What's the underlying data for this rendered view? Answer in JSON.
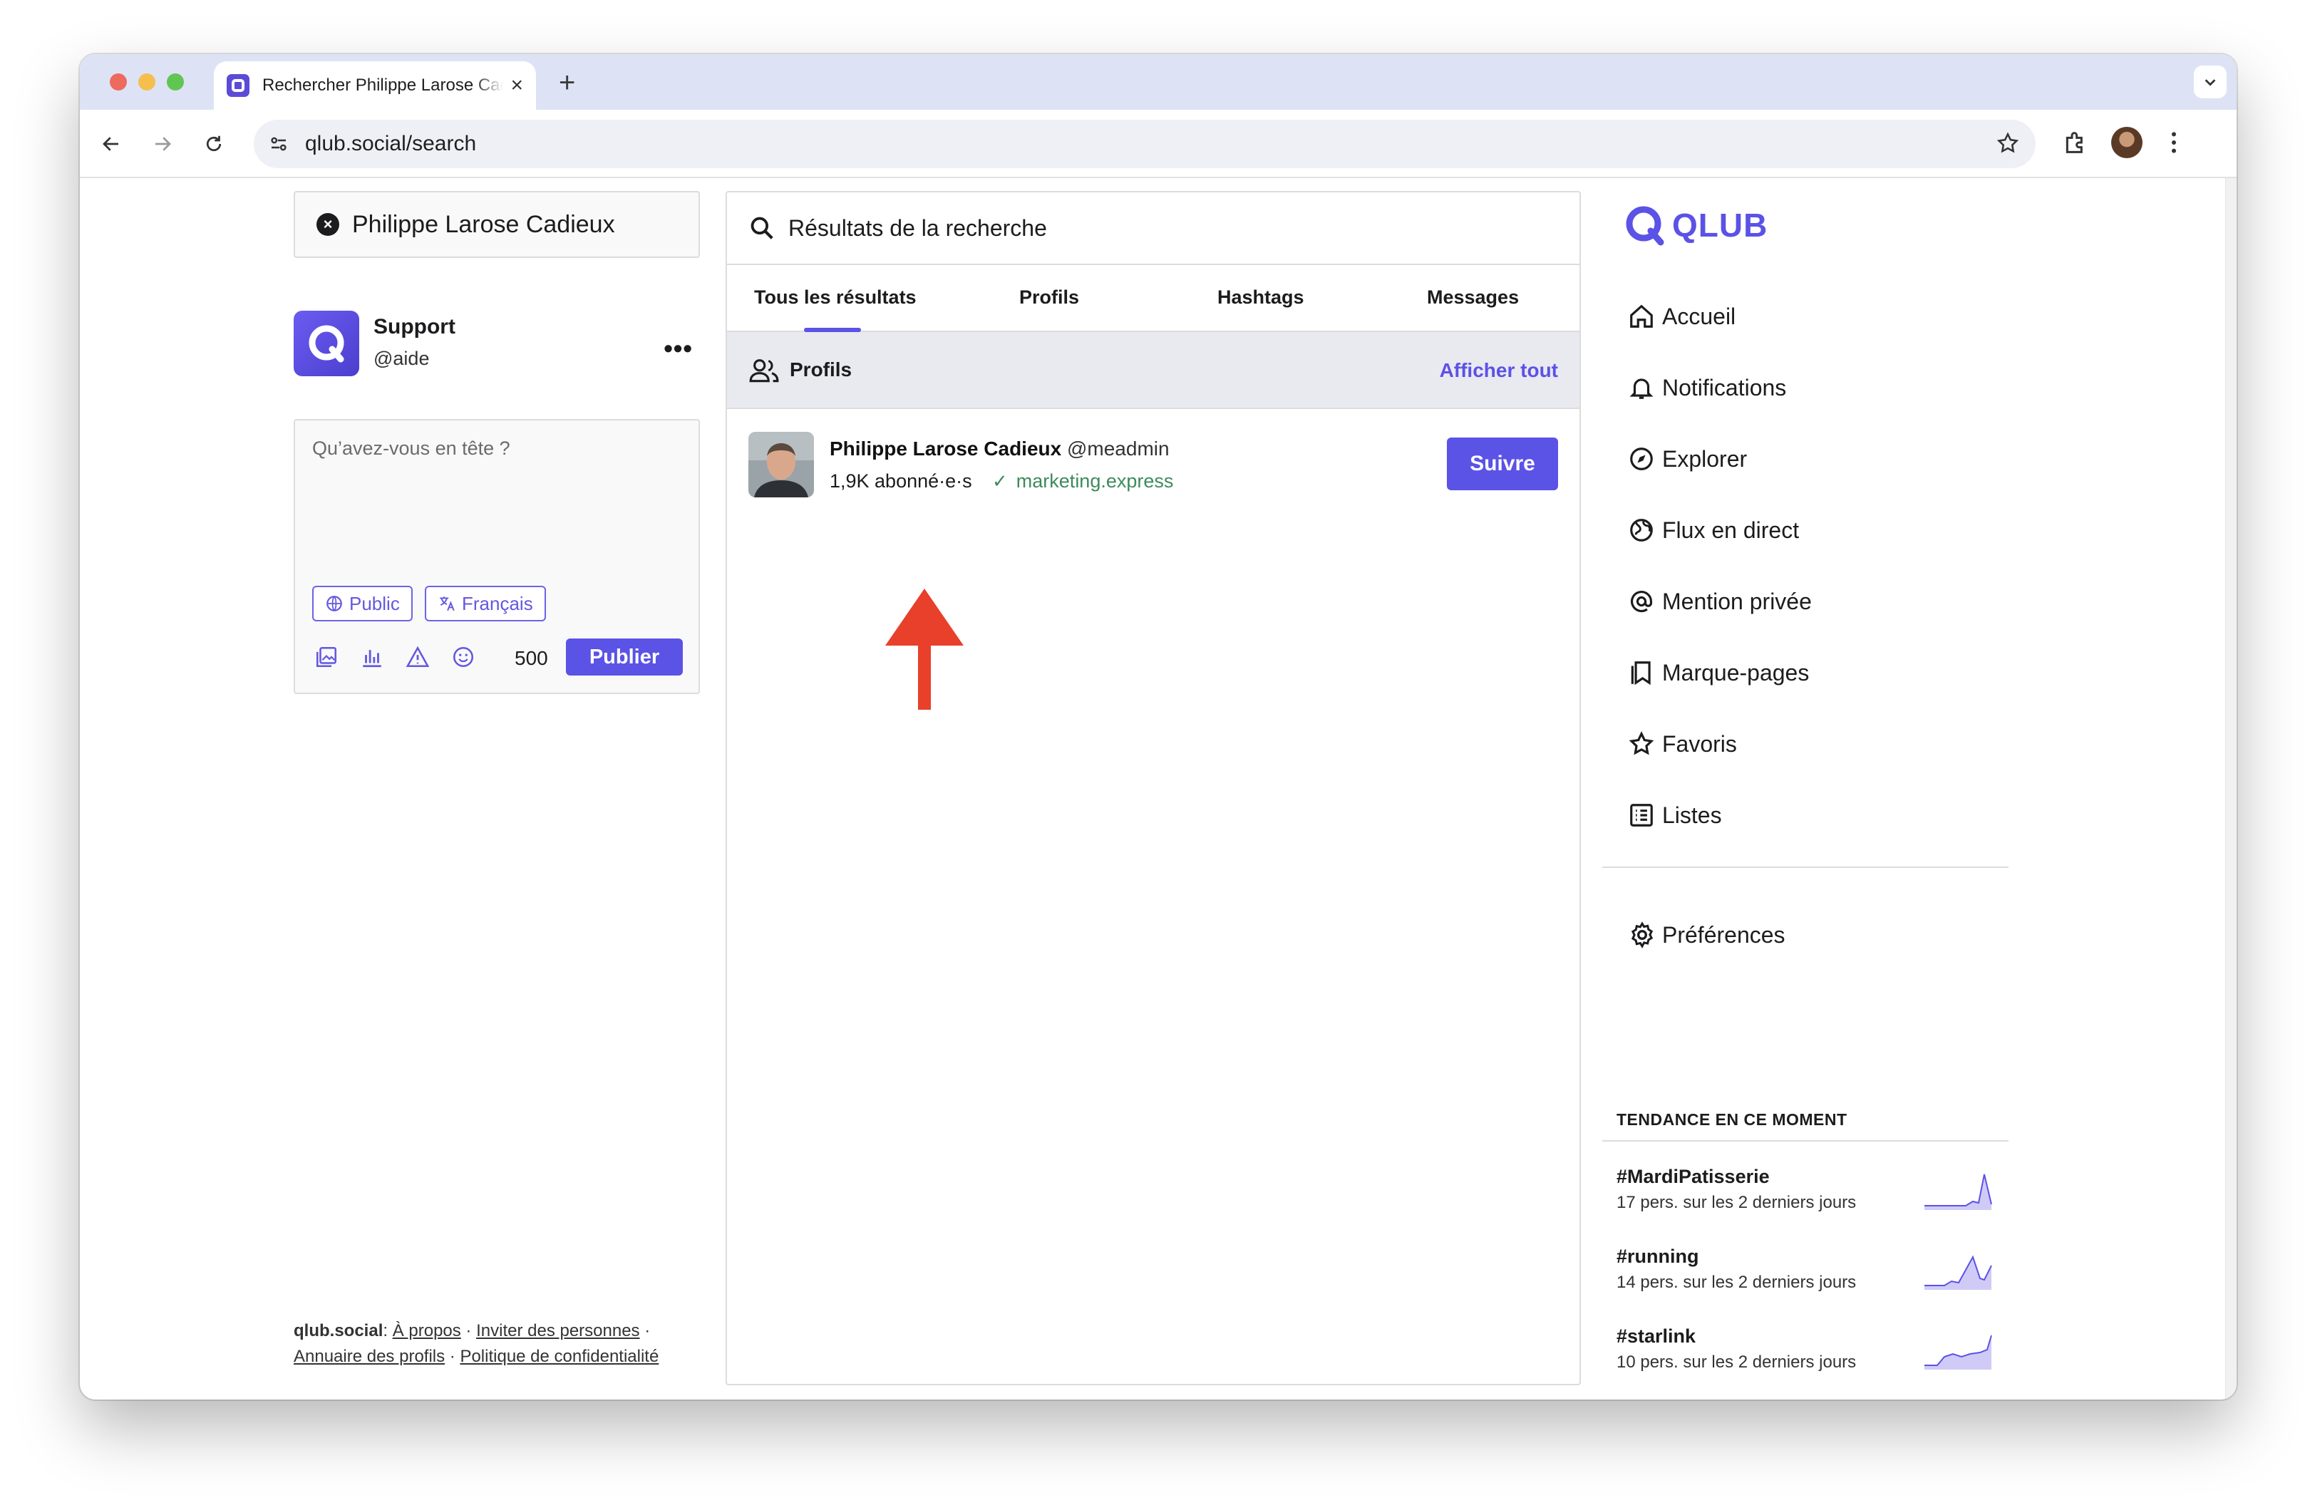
{
  "browser": {
    "tab_title": "Rechercher Philippe Larose Cadieux",
    "url": "qlub.social/search"
  },
  "left": {
    "search_value": "Philippe Larose Cadieux",
    "account": {
      "name": "Support",
      "handle": "@aide",
      "menu": "•••"
    },
    "composer": {
      "placeholder": "Qu’avez-vous en tête ?",
      "visibility": "Public",
      "language": "Français",
      "char_count": "500",
      "publish_label": "Publier"
    },
    "footer": {
      "site": "qlub.social",
      "about": "À propos",
      "invite": "Inviter des personnes",
      "directory": "Annuaire des profils",
      "privacy": "Politique de confidentialité"
    }
  },
  "results": {
    "title": "Résultats de la recherche",
    "tabs": [
      "Tous les résultats",
      "Profils",
      "Hashtags",
      "Messages"
    ],
    "section_title": "Profils",
    "show_all": "Afficher tout",
    "profile": {
      "name": "Philippe Larose Cadieux",
      "handle": "@meadmin",
      "followers": "1,9K abonné·e·s",
      "verified_link": "marketing.express",
      "follow_label": "Suivre"
    }
  },
  "right": {
    "brand": "QLUB",
    "nav": [
      "Accueil",
      "Notifications",
      "Explorer",
      "Flux en direct",
      "Mention privée",
      "Marque-pages",
      "Favoris",
      "Listes"
    ],
    "preferences": "Préférences",
    "trending_title": "TENDANCE EN CE MOMENT",
    "trends": [
      {
        "tag": "#MardiPatisserie",
        "meta": "17 pers. sur les 2 derniers jours"
      },
      {
        "tag": "#running",
        "meta": "14 pers. sur les 2 derniers jours"
      },
      {
        "tag": "#starlink",
        "meta": "10 pers. sur les 2 derniers jours"
      }
    ]
  },
  "colors": {
    "accent": "#5b52e6",
    "verified": "#3d8a5c",
    "annotation": "#e8402a"
  }
}
